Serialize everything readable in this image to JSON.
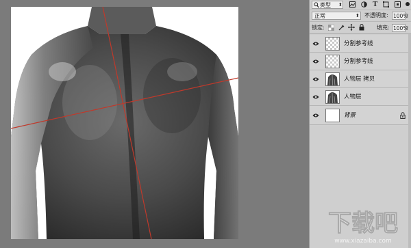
{
  "layers_panel": {
    "filter_kind_label": "类型",
    "blend_mode": "正常",
    "opacity_label": "不透明度:",
    "opacity_value": "100%",
    "lock_label": "锁定:",
    "fill_label": "填充:",
    "fill_value": "100%",
    "layers": [
      {
        "name": "分割参考线",
        "thumbnail": "transparent",
        "visible": true,
        "italic": false
      },
      {
        "name": "分割参考线",
        "thumbnail": "transparent",
        "visible": true,
        "italic": false
      },
      {
        "name": "人物层 拷贝",
        "thumbnail": "photo",
        "visible": true,
        "italic": false
      },
      {
        "name": "人物层",
        "thumbnail": "photo",
        "visible": true,
        "italic": false
      },
      {
        "name": "背景",
        "thumbnail": "white",
        "visible": true,
        "italic": true,
        "locked": true
      }
    ]
  },
  "watermark": {
    "title": "下载吧",
    "url": "www.xiazaiba.com"
  },
  "colors": {
    "guide_line": "#c0392b",
    "panel_bg": "#cfcfcf",
    "canvas_bg": "#7b7b7b"
  }
}
